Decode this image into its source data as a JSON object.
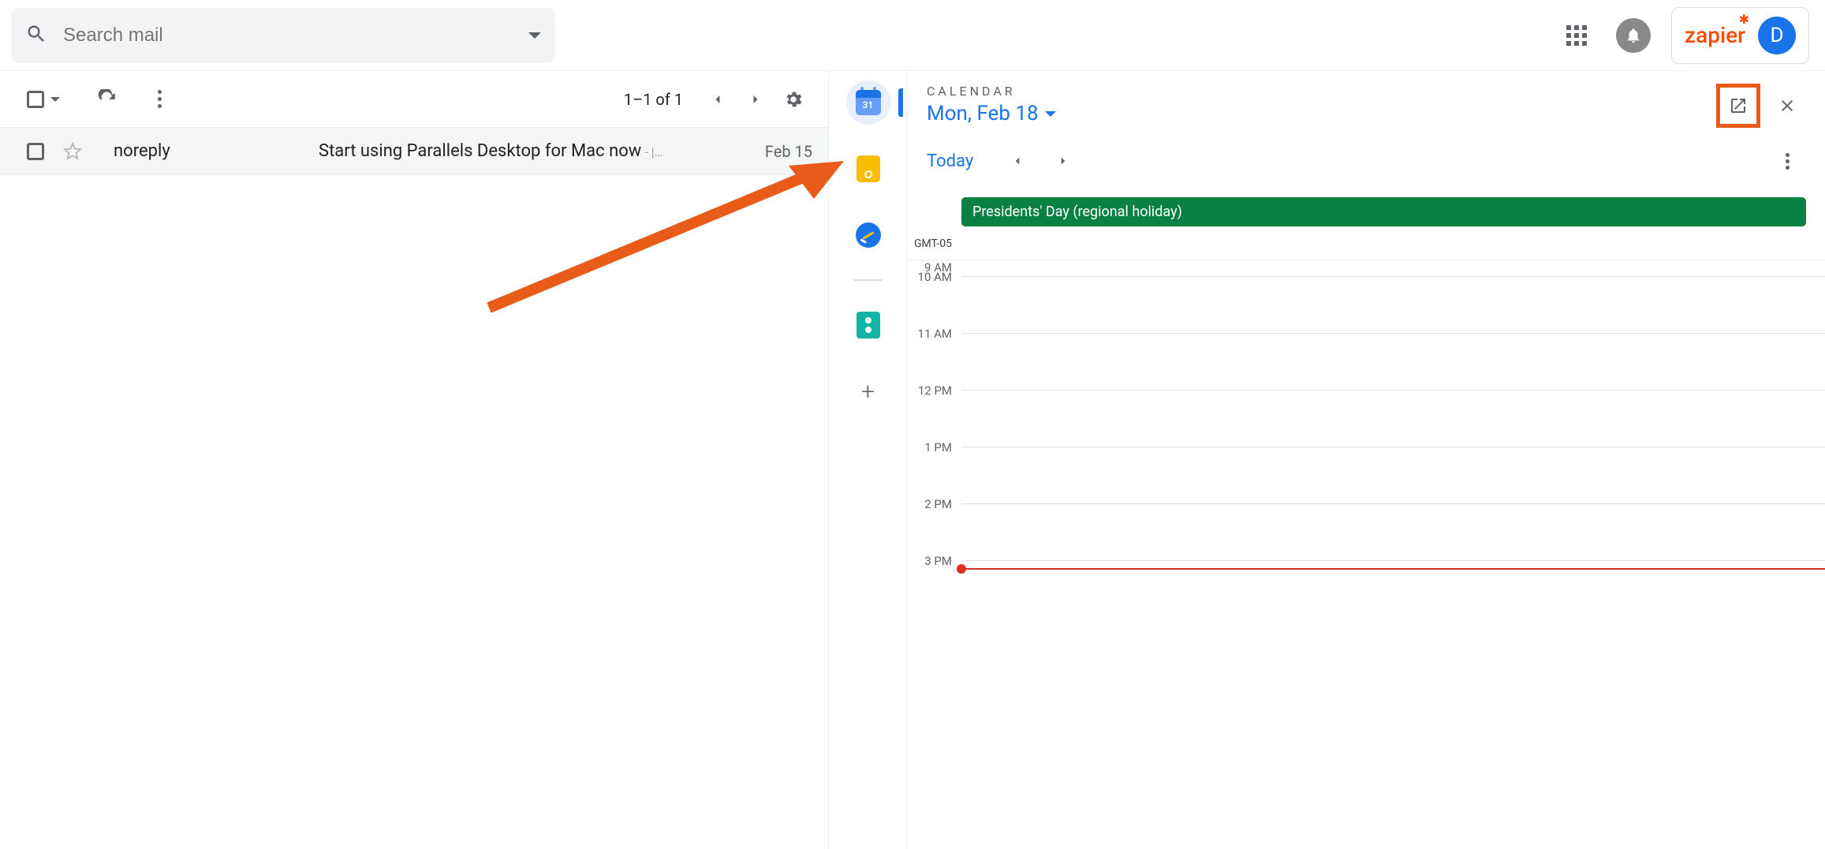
{
  "search": {
    "placeholder": "Search mail"
  },
  "brand": {
    "name": "zapier"
  },
  "avatar": {
    "initial": "D"
  },
  "toolbar": {
    "pager": "1–1 of 1"
  },
  "mail": {
    "sender": "noreply",
    "subject": "Start using Parallels Desktop for Mac now",
    "preview": " - |…",
    "date": "Feb 15"
  },
  "sidebar": {
    "calendar_day": "31"
  },
  "calendar": {
    "label": "CALENDAR",
    "date": "Mon, Feb 18",
    "today": "Today",
    "holiday": "Presidents' Day (regional holiday)",
    "timezone": "GMT-05",
    "hours": [
      "9 AM",
      "10 AM",
      "11 AM",
      "12 PM",
      "1 PM",
      "2 PM",
      "3 PM"
    ]
  }
}
